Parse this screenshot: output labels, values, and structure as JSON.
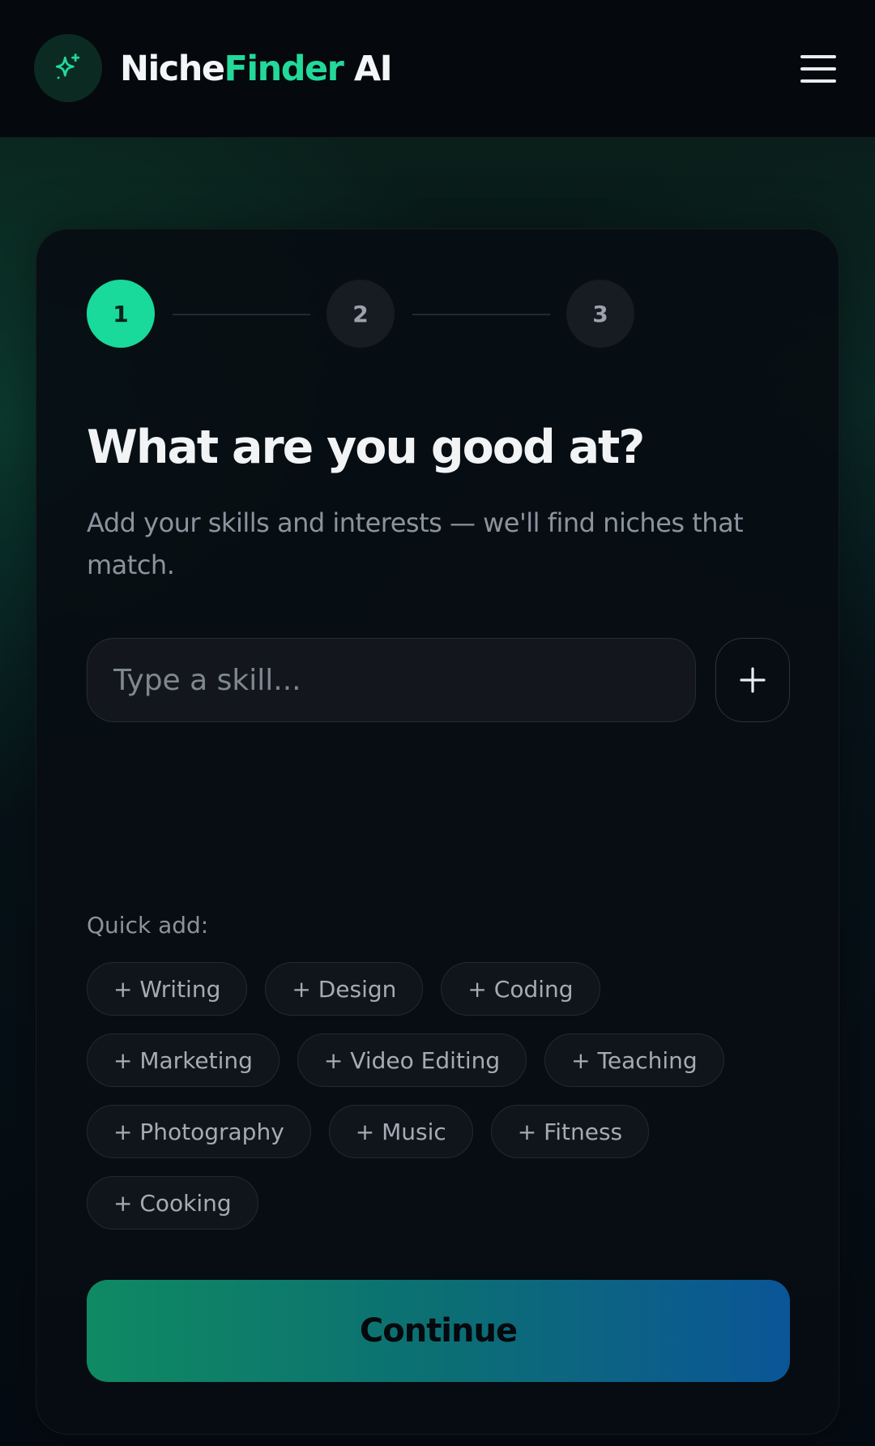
{
  "header": {
    "brand_part1": "Niche",
    "brand_part2": "Finder",
    "brand_part3": " AI",
    "logo_icon": "sparkles-icon",
    "menu_icon": "hamburger-menu-icon"
  },
  "stepper": {
    "steps": [
      "1",
      "2",
      "3"
    ],
    "current_step": 1
  },
  "main": {
    "title": "What are you good at?",
    "subtitle": "Add your skills and interests — we'll find niches that match.",
    "skill_input": {
      "value": "",
      "placeholder": "Type a skill..."
    },
    "add_button_icon": "plus-icon",
    "quick_add_label": "Quick add:",
    "chips": [
      "+ Writing",
      "+ Design",
      "+ Coding",
      "+ Marketing",
      "+ Video Editing",
      "+ Teaching",
      "+ Photography",
      "+ Music",
      "+ Fitness",
      "+ Cooking"
    ],
    "continue_label": "Continue"
  },
  "colors": {
    "accent": "#22d99a",
    "background": "#05080c",
    "button_gradient_start": "#0f8a62",
    "button_gradient_end": "#0b5597"
  }
}
